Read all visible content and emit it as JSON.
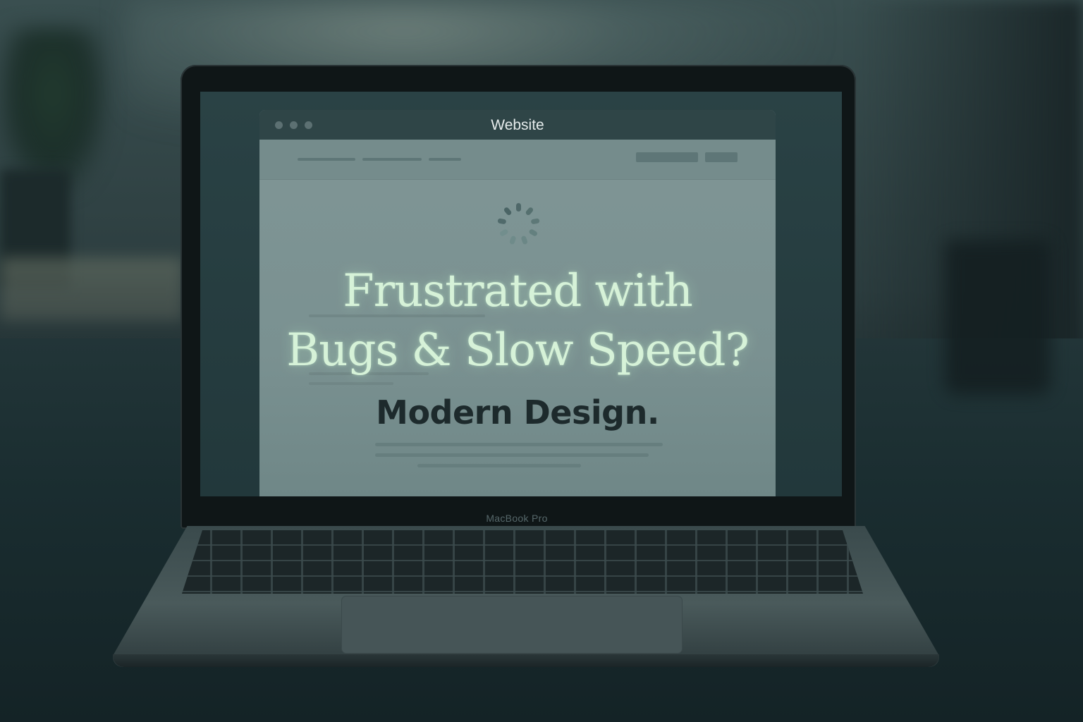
{
  "browser": {
    "window_title": "Website"
  },
  "hero": {
    "headline_line1": "Frustrated with",
    "headline_line2": "Bugs & Slow Speed?",
    "subheading": "Modern Design."
  },
  "laptop": {
    "model_label": "MacBook Pro"
  },
  "icons": {
    "loading": "loading-spinner-icon"
  },
  "colors": {
    "headline": "#d6f2d8",
    "subheading": "#1d2a2c",
    "page_background": "#7f9595"
  }
}
